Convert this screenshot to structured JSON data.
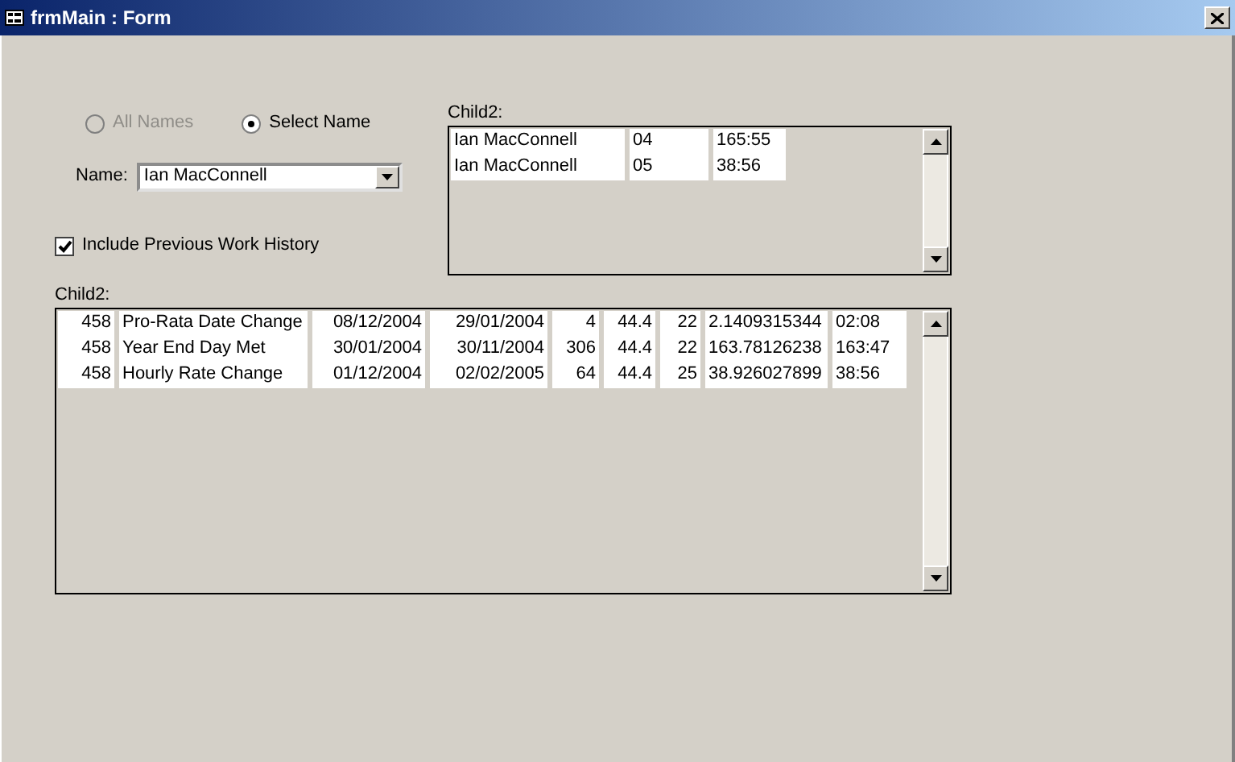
{
  "window": {
    "title": "frmMain : Form"
  },
  "options": [
    {
      "label": "All Names",
      "selected": false,
      "disabled": true
    },
    {
      "label": "Select Name",
      "selected": true,
      "disabled": false
    }
  ],
  "name_field": {
    "label": "Name:",
    "value": "Ian MacConnell"
  },
  "checkbox": {
    "label": "Include Previous Work History",
    "checked": true
  },
  "child_list_top": {
    "label": "Child2:",
    "rows": [
      [
        "Ian MacConnell",
        "04",
        "165:55"
      ],
      [
        "Ian MacConnell",
        "05",
        "38:56"
      ]
    ]
  },
  "child_list_bottom": {
    "label": "Child2:",
    "rows": [
      [
        "458",
        "Pro-Rata Date Change",
        "08/12/2004",
        "29/01/2004",
        "4",
        "44.4",
        "22",
        "2.1409315344",
        "02:08"
      ],
      [
        "458",
        "Year End Day Met",
        "30/01/2004",
        "30/11/2004",
        "306",
        "44.4",
        "22",
        "163.78126238",
        "163:47"
      ],
      [
        "458",
        "Hourly Rate Change",
        "01/12/2004",
        "02/02/2005",
        "64",
        "44.4",
        "25",
        "38.926027899",
        "38:56"
      ]
    ]
  }
}
